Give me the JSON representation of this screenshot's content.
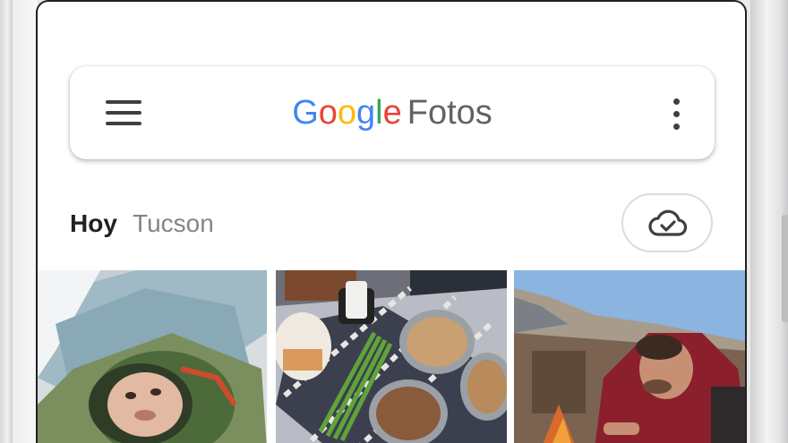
{
  "header": {
    "brand_google_letters": [
      {
        "char": "G",
        "color": "#4285F4"
      },
      {
        "char": "o",
        "color": "#EA4335"
      },
      {
        "char": "o",
        "color": "#FBBC05"
      },
      {
        "char": "g",
        "color": "#4285F4"
      },
      {
        "char": "l",
        "color": "#34A853"
      },
      {
        "char": "e",
        "color": "#EA4335"
      }
    ],
    "brand_product": "Fotos",
    "menu_icon": "hamburger-menu-icon",
    "more_icon": "more-vert-icon"
  },
  "section": {
    "date_label": "Hoy",
    "location_label": "Tucson",
    "backup_icon": "cloud-done-icon"
  },
  "photos": [
    {
      "subject": "person lying inside tent, selfie"
    },
    {
      "subject": "food bowls and green onions on patterned blanket"
    },
    {
      "subject": "man in red jacket crouching by campfire, mountains behind"
    }
  ]
}
